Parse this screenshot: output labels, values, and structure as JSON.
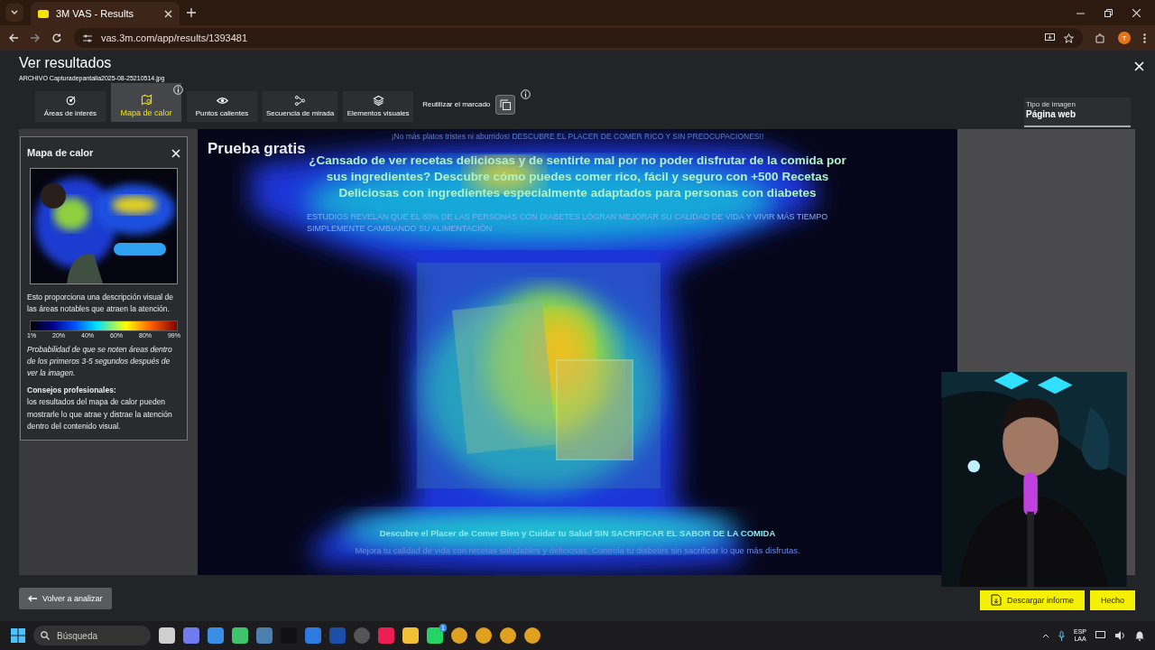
{
  "browser": {
    "tab_title": "3M VAS - Results",
    "url": "vas.3m.com/app/results/1393481",
    "profile_initial": "T"
  },
  "page": {
    "title": "Ver resultados",
    "file": "ARCHIVO Capturadepantalla2025-08-25210514.jpg"
  },
  "tabs": [
    {
      "label": "Áreas de interés",
      "kind": "target",
      "selected": false
    },
    {
      "label": "Mapa de calor",
      "kind": "map",
      "selected": true
    },
    {
      "label": "Puntos calientes",
      "kind": "eye",
      "selected": false
    },
    {
      "label": "Secuencia de mirada",
      "kind": "nodes",
      "selected": false
    },
    {
      "label": "Elementos visuales",
      "kind": "layers",
      "selected": false
    }
  ],
  "reuse": {
    "label": "Reutilizar el marcado"
  },
  "image_type": {
    "label": "Tipo de imagen",
    "value": "Página web"
  },
  "panel": {
    "title": "Mapa de calor",
    "description": "Esto proporciona una descripción visual de las áreas notables que atraen la atención.",
    "legend": [
      "1%",
      "20%",
      "40%",
      "60%",
      "80%",
      "99%"
    ],
    "note": "Probabilidad de que se noten áreas dentro de los primeros 3-5 segundos después de ver la imagen.",
    "tips_title": "Consejos profesionales:",
    "tips": "los resultados del mapa de calor pueden mostrarle lo que atrae y distrae la atención dentro del contenido visual."
  },
  "heatmap": {
    "kind": "picture",
    "texts": [
      {
        "kind": "banner",
        "text": "¡No más platos tristes ni aburridos! DESCUBRE EL PLACER DE COMER RICO Y SIN PREOCUPACIONES!!"
      },
      {
        "kind": "label",
        "text": "Prueba gratis"
      },
      {
        "kind": "headline",
        "text": "¿Cansado de ver recetas deliciosas y de sentirte mal por no poder disfrutar de la comida por sus ingredientes? Descubre cómo puedes comer rico, fácil y seguro con +500 Recetas Deliciosas con ingredientes especialmente adaptados para personas con diabetes"
      },
      {
        "kind": "study",
        "text": "ESTUDIOS REVELAN QUE EL 80% DE LAS PERSONAS CON DIABETES LOGRAN MEJORAR SU CALIDAD DE VIDA Y VIVIR MÁS TIEMPO SIMPLEMENTE CAMBIANDO SU ALIMENTACIÓN"
      },
      {
        "kind": "subhead",
        "text": "Descubre el Placer de Comer Bien y Cuidar tu Salud SIN SACRIFICAR EL SABOR DE LA COMIDA"
      },
      {
        "kind": "note",
        "text": "Mejora tu calidad de vida con recetas saludables y deliciosas. Controla tu diabetes sin sacrificar lo que más disfrutas."
      }
    ]
  },
  "buttons": {
    "back": "Volver a analizar",
    "download": "Descargar informe",
    "done": "Hecho"
  },
  "taskbar": {
    "search_placeholder": "Búsqueda",
    "apps": [
      {
        "kind": "files"
      },
      {
        "kind": "copilot"
      },
      {
        "kind": "store"
      },
      {
        "kind": "play"
      },
      {
        "kind": "steam"
      },
      {
        "kind": "dark"
      },
      {
        "kind": "bluetooth"
      },
      {
        "kind": "playstation"
      },
      {
        "kind": "record"
      },
      {
        "kind": "tiktok"
      },
      {
        "kind": "folder"
      },
      {
        "kind": "chat",
        "badge": "1"
      },
      {
        "kind": "browser"
      },
      {
        "kind": "browser"
      },
      {
        "kind": "browser"
      },
      {
        "kind": "browser"
      }
    ],
    "language": "ESP",
    "layout": "LAA"
  }
}
